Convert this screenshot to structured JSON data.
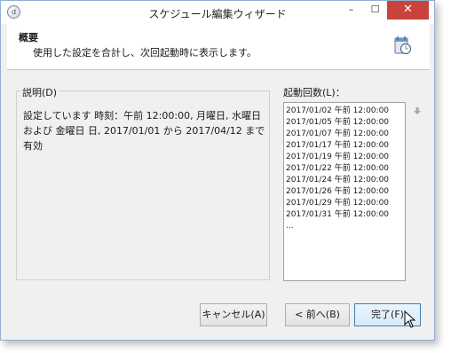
{
  "window": {
    "title": "スケジュール編集ウィザード",
    "app_icon_glyph": "d",
    "min_glyph": "–",
    "max_glyph": "☐",
    "close_glyph": "✕"
  },
  "header": {
    "title": "概要",
    "subtitle": "使用した設定を合計し、次回起動時に表示します。",
    "icon": "schedule-clock-icon"
  },
  "description": {
    "label": "説明(D)",
    "text": "設定しています 時刻：午前 12:00:00, 月曜日, 水曜日 および 金曜日 日, 2017/01/01 から 2017/04/12 まで有効"
  },
  "runs": {
    "label": "起動回数(L)：",
    "items": [
      "2017/01/02 午前 12:00:00",
      "2017/01/05 午前 12:00:00",
      "2017/01/07 午前 12:00:00",
      "2017/01/17 午前 12:00:00",
      "2017/01/19 午前 12:00:00",
      "2017/01/22 午前 12:00:00",
      "2017/01/24 午前 12:00:00",
      "2017/01/26 午前 12:00:00",
      "2017/01/29 午前 12:00:00",
      "2017/01/31 午前 12:00:00",
      "..."
    ]
  },
  "buttons": {
    "cancel": "キャンセル(A)",
    "back": "< 前へ(B)",
    "finish": "完了(F)"
  },
  "colors": {
    "close_button": "#c7433b",
    "window_border": "#8fb0d3",
    "finish_border": "#3c7fb1"
  }
}
